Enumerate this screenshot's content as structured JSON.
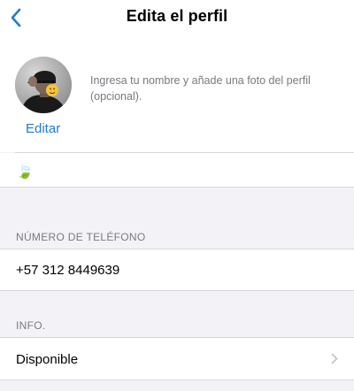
{
  "nav": {
    "title": "Edita el perfil",
    "back_icon": "chevron-left-icon"
  },
  "profile": {
    "hint": "Ingresa tu nombre y añade una foto del perfil (opcional).",
    "edit_label": "Editar",
    "name_value": "🍃",
    "name_icon": "leaf-emoji"
  },
  "phone_section": {
    "header": "NÚMERO DE TELÉFONO",
    "number": "+57 312 8449639"
  },
  "info_section": {
    "header": "INFO.",
    "status": "Disponible",
    "chevron_icon": "chevron-right-icon"
  },
  "colors": {
    "accent": "#1f7ad6",
    "background": "#f2f2f7",
    "secondary_text": "#7a7a80",
    "separator": "#d8d8dc"
  }
}
